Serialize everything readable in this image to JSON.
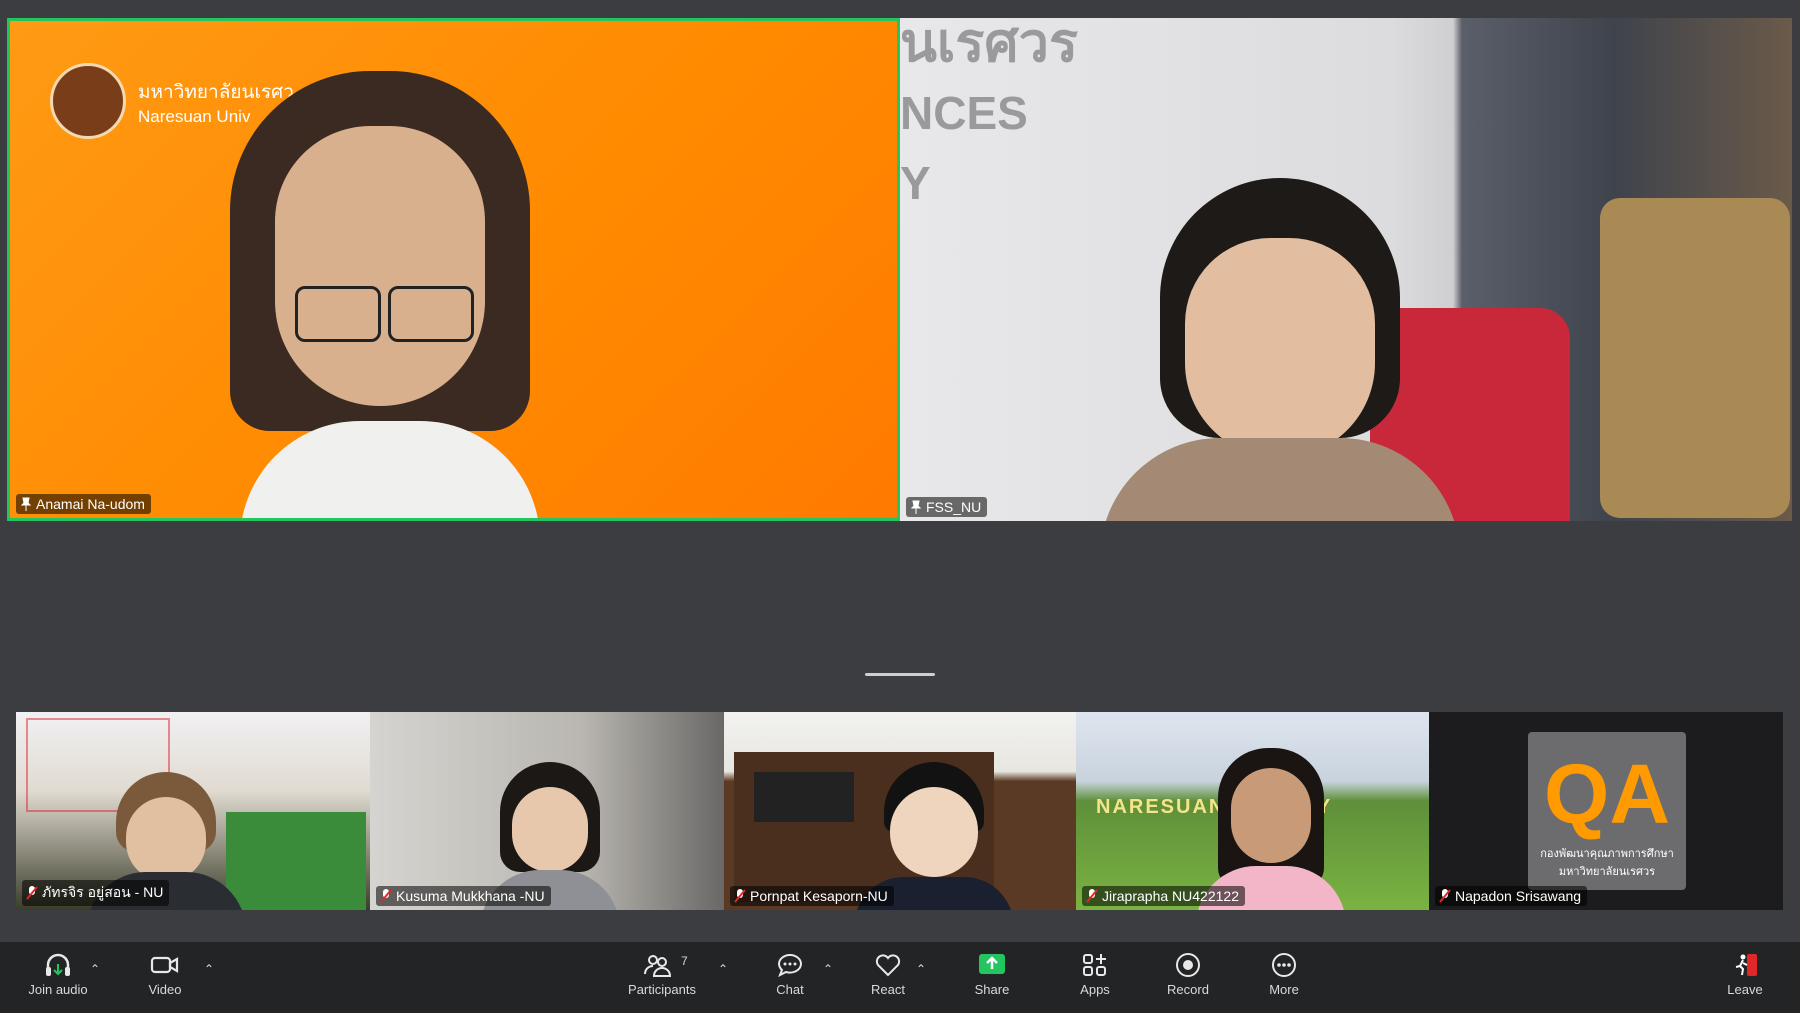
{
  "main_tiles": [
    {
      "name": "Anamai Na-udom",
      "logo_text_th": "มหาวิทยาลัยนเรศว",
      "logo_text_en": "Naresuan Univ",
      "active": true
    },
    {
      "name": "FSS_NU",
      "wall_text": [
        "นเรศวร",
        "NCES",
        "Y"
      ]
    }
  ],
  "strip_tiles": [
    {
      "name": "ภัทรจิร อยู่สอน - NU"
    },
    {
      "name": "Kusuma Mukkhana -NU"
    },
    {
      "name": "Pornpat Kesaporn-NU"
    },
    {
      "name": "Jiraprapha NU422122",
      "sign_text": "NARESUAN   ERSITY"
    },
    {
      "name": "Napadon Srisawang",
      "qa_logo_text": "QA",
      "qa_logo_sub1": "กองพัฒนาคุณภาพการศึกษา",
      "qa_logo_sub2": "มหาวิทยาลัยนเรศวร"
    }
  ],
  "toolbar": {
    "join_audio": "Join audio",
    "video": "Video",
    "participants": "Participants",
    "participants_count": "7",
    "chat": "Chat",
    "react": "React",
    "share": "Share",
    "apps": "Apps",
    "record": "Record",
    "more": "More",
    "leave": "Leave"
  },
  "colors": {
    "active_border": "#22c55e",
    "share_green": "#22c55e",
    "leave_red": "#e02828",
    "orange_bg": "#ff8a00"
  }
}
